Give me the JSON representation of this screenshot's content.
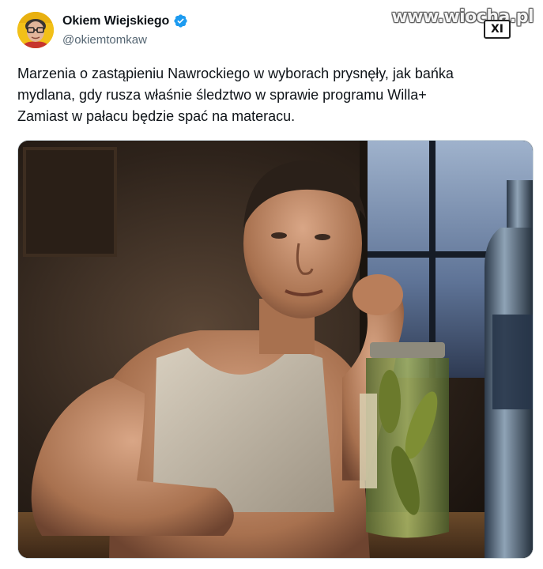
{
  "author": {
    "display_name": "Okiem Wiejskiego",
    "handle": "@okiemtomkaw",
    "verified": true,
    "avatar_icon": "avatar-portrait-icon",
    "avatar_bg": "#f2c018"
  },
  "watermark": {
    "site": "www.wiocha.pl",
    "badge": "XI"
  },
  "tweet": {
    "lines": [
      "Marzenia o zastąpieniu Nawrockiego w wyborach prysnęły, jak bańka",
      "mydlana, gdy rusza właśnie śledztwo w sprawie programu Willa+",
      "Zamiast w pałacu będzie spać na materacu."
    ]
  },
  "media": {
    "type": "photo",
    "subject_icon": "photo-man-with-pickle-jar-and-bottle"
  },
  "colors": {
    "verified": "#1d9bf0",
    "text": "#0f1419",
    "secondary": "#536471",
    "border": "#cfd9de"
  }
}
